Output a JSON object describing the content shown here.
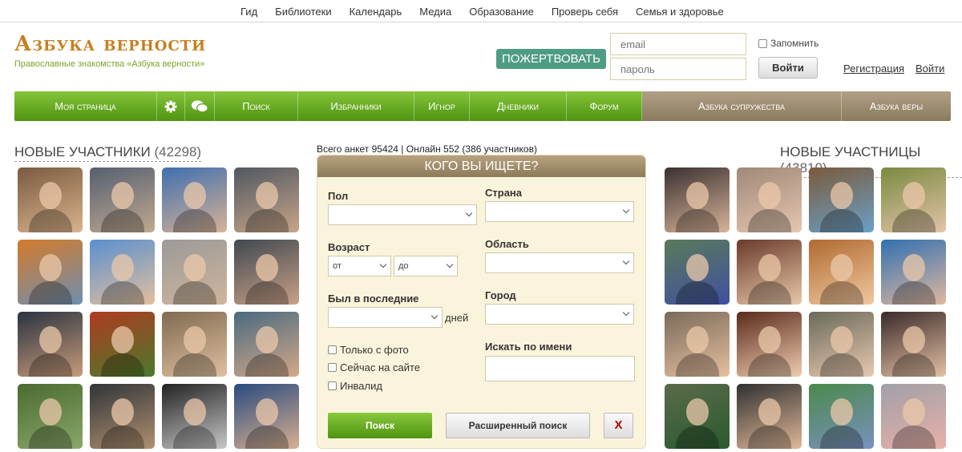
{
  "topnav": [
    "Гид",
    "Библиотеки",
    "Календарь",
    "Медиа",
    "Образование",
    "Проверь себя",
    "Семья и здоровье"
  ],
  "site": {
    "logo": "Азбука верности",
    "tagline": "Православные знакомства «Азбука верности»"
  },
  "header": {
    "donate": "ПОЖЕРТВОВАТЬ",
    "email_placeholder": "email",
    "password_placeholder": "пароль",
    "remember": "Запомнить",
    "login_button": "Войти",
    "register": "Регистрация",
    "login_link": "Войти"
  },
  "mainnav": {
    "my_page": "Моя страница",
    "settings_icon": "gear-icon",
    "chat_icon": "chat-icon",
    "search": "Поиск",
    "favorites": "Избранники",
    "ignore": "Игнор",
    "diaries": "Дневники",
    "forum": "Форум",
    "marriage": "Азбука супружества",
    "faith": "Азбука веры"
  },
  "left": {
    "title": "НОВЫЕ УЧАСТНИКИ",
    "count": "(42298)"
  },
  "right": {
    "title": "НОВЫЕ УЧАСТНИЦЫ",
    "count": "(43810)"
  },
  "stats": "Всего анкет 95424 | Онлайн 552 (386 участников)",
  "search": {
    "title": "КОГО ВЫ ИЩЕТЕ?",
    "gender_label": "Пол",
    "age_label": "Возраст",
    "age_from": "от",
    "age_to": "до",
    "last_seen_label": "Был в последние",
    "days": "дней",
    "only_photo": "Только с фото",
    "online_now": "Сейчас на сайте",
    "disabled": "Инвалид",
    "country_label": "Страна",
    "region_label": "Область",
    "city_label": "Город",
    "by_name_label": "Искать по имени",
    "search_button": "Поиск",
    "advanced_button": "Расширенный поиск",
    "reset_button": "X"
  },
  "colors": {
    "green": "#6cb126",
    "brown": "#9c8b6d",
    "logo": "#c87f1e",
    "donate": "#4f9c84"
  }
}
